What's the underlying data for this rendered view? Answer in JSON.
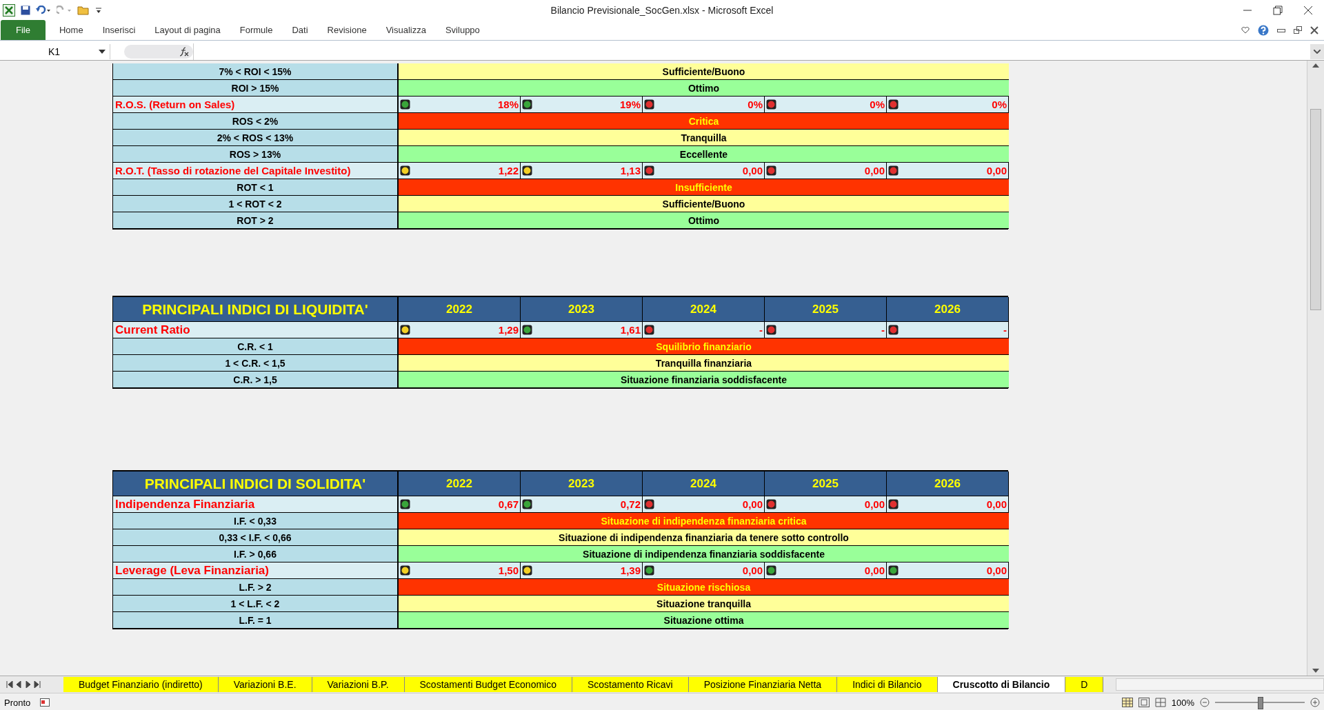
{
  "window": {
    "title": "Bilancio Previsionale_SocGen.xlsx - Microsoft Excel"
  },
  "ribbon_tabs": [
    {
      "label": "File",
      "selected": true
    },
    {
      "label": "Home",
      "selected": false
    },
    {
      "label": "Inserisci",
      "selected": false
    },
    {
      "label": "Layout di pagina",
      "selected": false
    },
    {
      "label": "Formule",
      "selected": false
    },
    {
      "label": "Dati",
      "selected": false
    },
    {
      "label": "Revisione",
      "selected": false
    },
    {
      "label": "Visualizza",
      "selected": false
    },
    {
      "label": "Sviluppo",
      "selected": false
    }
  ],
  "name_box": "K1",
  "sections": [
    {
      "rows": [
        {
          "kind": "band",
          "label": "7% < ROI < 15%",
          "verdict": "Sufficiente/Buono",
          "color": "#ffff99"
        },
        {
          "kind": "band",
          "label": "ROI > 15%",
          "verdict": "Ottimo",
          "color": "#99ff99"
        },
        {
          "kind": "indicator",
          "label": "R.O.S. (Return on Sales)",
          "values": [
            {
              "color": "#3aa53a",
              "value": "18%"
            },
            {
              "color": "#3aa53a",
              "value": "19%"
            },
            {
              "color": "#e03030",
              "value": "0%"
            },
            {
              "color": "#e03030",
              "value": "0%"
            },
            {
              "color": "#e03030",
              "value": "0%"
            }
          ]
        },
        {
          "kind": "band",
          "label": "ROS < 2%",
          "verdict": "Critica",
          "color": "#ff3300"
        },
        {
          "kind": "band",
          "label": "2% < ROS < 13%",
          "verdict": "Tranquilla",
          "color": "#ffff99"
        },
        {
          "kind": "band",
          "label": "ROS > 13%",
          "verdict": "Eccellente",
          "color": "#99ff99"
        },
        {
          "kind": "indicator",
          "label": "R.O.T. (Tasso di rotazione del Capitale Investito)",
          "values": [
            {
              "color": "#f2d024",
              "value": "1,22"
            },
            {
              "color": "#f2d024",
              "value": "1,13"
            },
            {
              "color": "#e03030",
              "value": "0,00"
            },
            {
              "color": "#e03030",
              "value": "0,00"
            },
            {
              "color": "#e03030",
              "value": "0,00"
            }
          ]
        },
        {
          "kind": "band",
          "label": "ROT < 1",
          "verdict": "Insufficiente",
          "color": "#ff3300"
        },
        {
          "kind": "band",
          "label": "1 < ROT < 2",
          "verdict": "Sufficiente/Buono",
          "color": "#ffff99"
        },
        {
          "kind": "band",
          "label": "ROT > 2",
          "verdict": "Ottimo",
          "color": "#99ff99"
        }
      ]
    },
    {
      "title": "PRINCIPALI INDICI DI LIQUIDITA'",
      "years": [
        "2022",
        "2023",
        "2024",
        "2025",
        "2026"
      ],
      "rows": [
        {
          "kind": "indicator",
          "label": "Current Ratio",
          "values": [
            {
              "color": "#f2d024",
              "value": "1,29"
            },
            {
              "color": "#3aa53a",
              "value": "1,61"
            },
            {
              "color": "#e03030",
              "value": "-"
            },
            {
              "color": "#e03030",
              "value": "-"
            },
            {
              "color": "#e03030",
              "value": "-"
            }
          ]
        },
        {
          "kind": "band",
          "label": "C.R. < 1",
          "verdict": "Squilibrio finanziario",
          "color": "#ff3300"
        },
        {
          "kind": "band",
          "label": "1 < C.R. < 1,5",
          "verdict": "Tranquilla finanziaria",
          "color": "#ffff99"
        },
        {
          "kind": "band",
          "label": "C.R. > 1,5",
          "verdict": "Situazione finanziaria soddisfacente",
          "color": "#99ff99"
        }
      ]
    },
    {
      "title": "PRINCIPALI INDICI DI SOLIDITA'",
      "years": [
        "2022",
        "2023",
        "2024",
        "2025",
        "2026"
      ],
      "rows": [
        {
          "kind": "indicator",
          "label": "Indipendenza Finanziaria",
          "values": [
            {
              "color": "#3aa53a",
              "value": "0,67"
            },
            {
              "color": "#3aa53a",
              "value": "0,72"
            },
            {
              "color": "#e03030",
              "value": "0,00"
            },
            {
              "color": "#e03030",
              "value": "0,00"
            },
            {
              "color": "#e03030",
              "value": "0,00"
            }
          ]
        },
        {
          "kind": "band",
          "label": "I.F. < 0,33",
          "verdict": "Situazione di indipendenza finanziaria critica",
          "color": "#ff3300"
        },
        {
          "kind": "band",
          "label": "0,33 < I.F. < 0,66",
          "verdict": "Situazione di indipendenza finanziaria da tenere sotto controllo",
          "color": "#ffff99"
        },
        {
          "kind": "band",
          "label": "I.F. > 0,66",
          "verdict": "Situazione di indipendenza finanziaria soddisfacente",
          "color": "#99ff99"
        },
        {
          "kind": "indicator",
          "label": "Leverage (Leva Finanziaria)",
          "values": [
            {
              "color": "#f2d024",
              "value": "1,50"
            },
            {
              "color": "#f2d024",
              "value": "1,39"
            },
            {
              "color": "#3aa53a",
              "value": "0,00"
            },
            {
              "color": "#3aa53a",
              "value": "0,00"
            },
            {
              "color": "#3aa53a",
              "value": "0,00"
            }
          ]
        },
        {
          "kind": "band",
          "label": "L.F. > 2",
          "verdict": "Situazione rischiosa",
          "color": "#ff3300"
        },
        {
          "kind": "band",
          "label": "1 < L.F. < 2",
          "verdict": "Situazione tranquilla",
          "color": "#ffff99"
        },
        {
          "kind": "band",
          "label": "L.F. = 1",
          "verdict": "Situazione ottima",
          "color": "#99ff99"
        }
      ]
    }
  ],
  "sheet_tabs": [
    {
      "label": "Budget Finanziario (indiretto)",
      "selected": false
    },
    {
      "label": "Variazioni B.E.",
      "selected": false
    },
    {
      "label": "Variazioni B.P.",
      "selected": false
    },
    {
      "label": "Scostamenti Budget Economico",
      "selected": false
    },
    {
      "label": "Scostamento Ricavi",
      "selected": false
    },
    {
      "label": "Posizione Finanziaria Netta",
      "selected": false
    },
    {
      "label": "Indici di Bilancio",
      "selected": false
    },
    {
      "label": "Cruscotto di Bilancio",
      "selected": true
    },
    {
      "label": "D",
      "selected": false
    }
  ],
  "status_bar": {
    "mode": "Pronto",
    "zoom": "100%",
    "zoom_slider": {
      "level": 0.5
    }
  }
}
